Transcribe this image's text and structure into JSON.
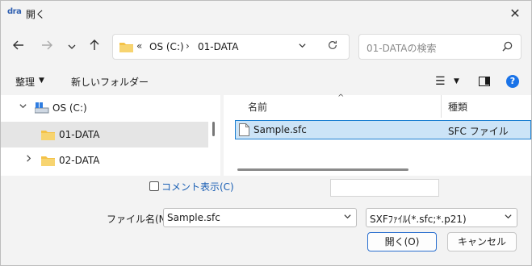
{
  "window": {
    "app_icon_text": "dra",
    "title": "開く"
  },
  "nav": {
    "address": {
      "overflow": "«",
      "segments": [
        "OS (C:)",
        "01-DATA"
      ],
      "separator": "›"
    },
    "search_placeholder": "01-DATAの検索"
  },
  "toolbar": {
    "organize": "整理",
    "new_folder": "新しいフォルダー"
  },
  "tree": {
    "items": [
      {
        "label": "OS (C:)",
        "expanded": true
      },
      {
        "label": "01-DATA",
        "selected": true
      },
      {
        "label": "02-DATA",
        "expanded": false
      }
    ]
  },
  "files": {
    "columns": {
      "name": "名前",
      "type": "種類"
    },
    "rows": [
      {
        "name": "Sample.sfc",
        "type": "SFC ファイル",
        "selected": true
      }
    ]
  },
  "footer": {
    "comment_label": "コメント表示(C)",
    "comment_checked": false,
    "file_name_label": "ファイル名(N):",
    "file_name_value": "Sample.sfc",
    "file_type_value": "SXFﾌｧｲﾙ(*.sfc;*.p21)",
    "open_button": "開く(O)",
    "cancel_button": "キャンセル"
  },
  "colors": {
    "accent": "#1a73e8",
    "selection_bg": "#cce4f7",
    "selection_border": "#1b7fd1",
    "folder": "#f4c247"
  }
}
